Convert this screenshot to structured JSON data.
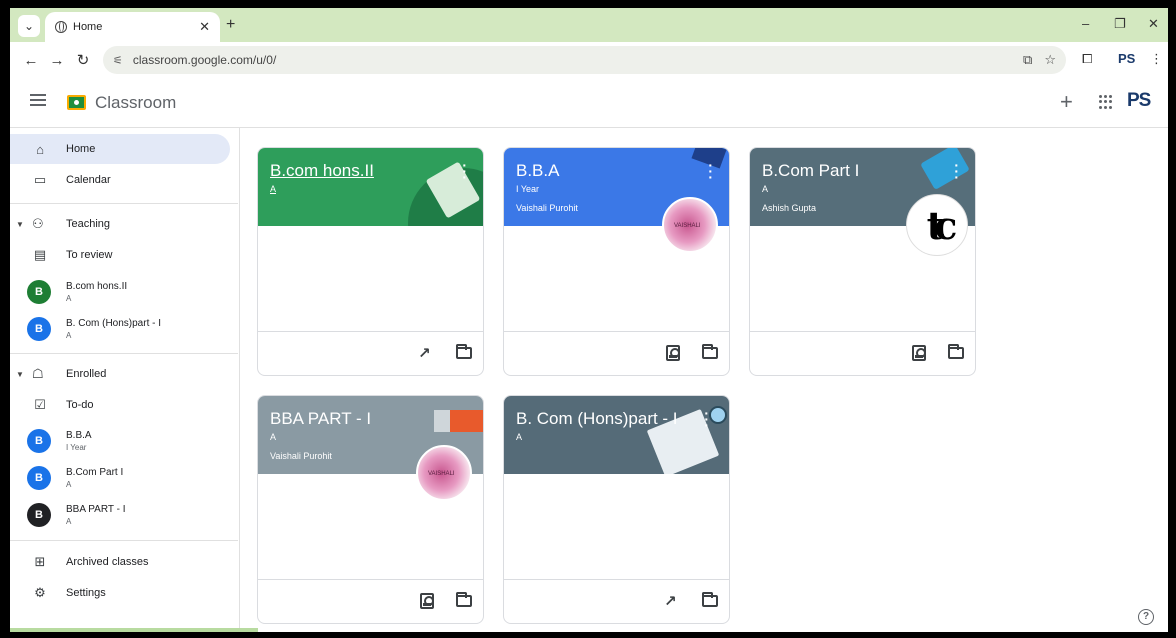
{
  "browser": {
    "tab_title": "Home",
    "url": "classroom.google.com/u/0/",
    "profile_initials": "PS"
  },
  "app": {
    "title": "Classroom",
    "avatar": "PS"
  },
  "sidebar": {
    "home": "Home",
    "calendar": "Calendar",
    "teaching": "Teaching",
    "to_review": "To review",
    "teaching_classes": [
      {
        "initial": "B",
        "name": "B.com hons.II",
        "section": "A",
        "color": "#1e7e34"
      },
      {
        "initial": "B",
        "name": "B. Com (Hons)part - I",
        "section": "A",
        "color": "#1a73e8"
      }
    ],
    "enrolled": "Enrolled",
    "todo": "To-do",
    "enrolled_classes": [
      {
        "initial": "B",
        "name": "B.B.A",
        "section": "I Year",
        "color": "#1a73e8"
      },
      {
        "initial": "B",
        "name": "B.Com Part I",
        "section": "A",
        "color": "#1a73e8"
      },
      {
        "initial": "B",
        "name": "BBA PART - I",
        "section": "A",
        "color": "#202124"
      }
    ],
    "archived": "Archived classes",
    "settings": "Settings"
  },
  "cards": [
    {
      "title": "B.com hons.II",
      "section": "A",
      "teacher": "",
      "color": "#2e9e5b"
    },
    {
      "title": "B.B.A",
      "section": "I Year",
      "teacher": "Vaishali Purohit",
      "color": "#3b78e7",
      "avatar_text": "VAISHALI"
    },
    {
      "title": "B.Com Part I",
      "section": "A",
      "teacher": "Ashish Gupta",
      "color": "#566e7a",
      "avatar_text": "tc"
    },
    {
      "title": "BBA PART - I",
      "section": "A",
      "teacher": "Vaishali Purohit",
      "color": "#8a9aa3",
      "avatar_text": "VAISHALI"
    },
    {
      "title": "B. Com (Hons)part - I",
      "section": "A",
      "teacher": "",
      "color": "#556b78"
    }
  ]
}
